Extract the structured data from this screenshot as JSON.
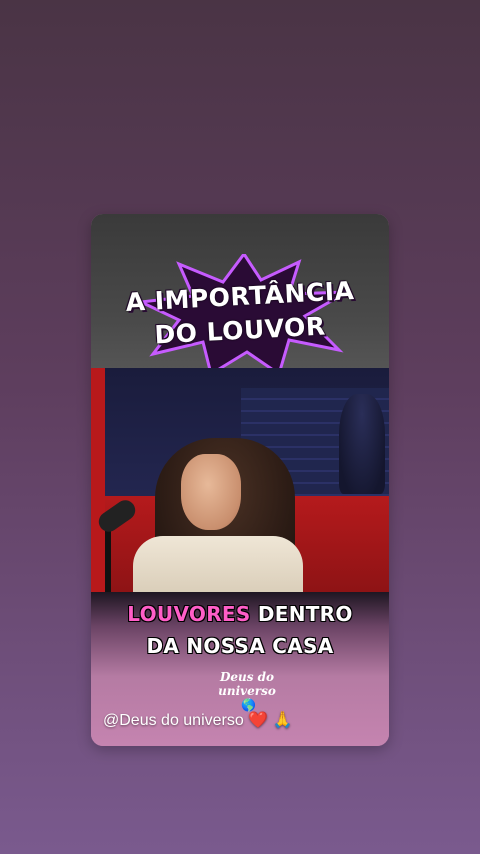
{
  "header": {
    "title_line1": "A IMPORTÂNCIA",
    "title_line2": "DO LOUVOR"
  },
  "caption": {
    "line1_highlight": "LOUVORES",
    "line1_rest": " DENTRO",
    "line2": "DA NOSSA CASA"
  },
  "watermark": {
    "line1": "Deus do",
    "line2": "universo",
    "icon": "globe-icon"
  },
  "handle": {
    "text": "@Deus do universo",
    "emoji_heart": "❤️",
    "emoji_pray": "🙏"
  },
  "colors": {
    "highlight": "#ff5ec8",
    "burst": "#b847e6"
  }
}
